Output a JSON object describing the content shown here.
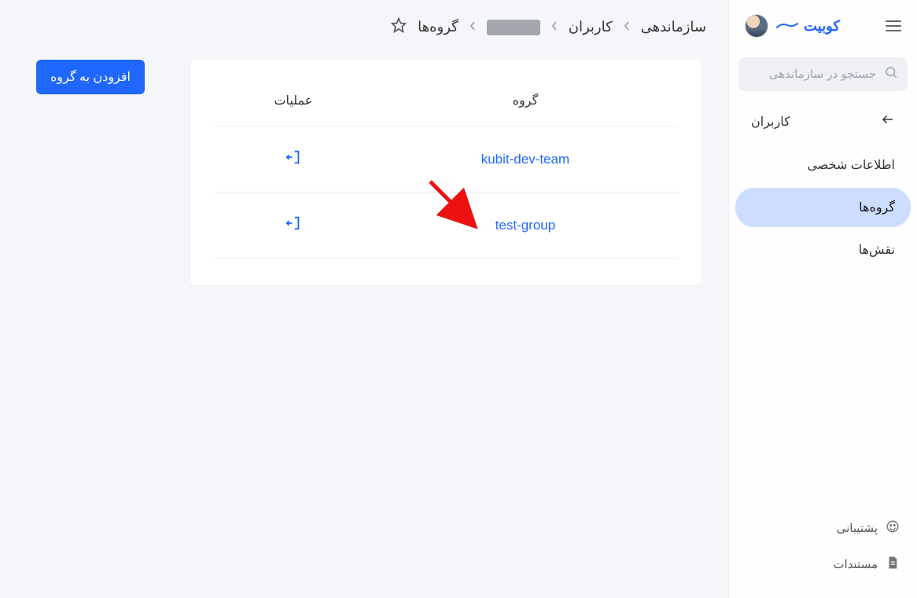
{
  "brand": {
    "name": "کوبیت"
  },
  "search": {
    "placeholder": "جستجو در سازماندهی"
  },
  "sidebar": {
    "items": [
      {
        "label": "کاربران",
        "active": false,
        "has_back": true
      },
      {
        "label": "اطلاعات شخصی",
        "active": false,
        "has_back": false
      },
      {
        "label": "گروه‌ها",
        "active": true,
        "has_back": false
      },
      {
        "label": "نقش‌ها",
        "active": false,
        "has_back": false
      }
    ]
  },
  "footer": {
    "items": [
      {
        "label": "پشتیبانی",
        "icon": "support-icon"
      },
      {
        "label": "مستندات",
        "icon": "document-icon"
      }
    ]
  },
  "breadcrumb": {
    "items": [
      {
        "label": "سازماندهی"
      },
      {
        "label": "کاربران"
      },
      {
        "label": "[redacted]",
        "redacted": true
      },
      {
        "label": "گروه‌ها"
      }
    ]
  },
  "buttons": {
    "add_to_group": "افزودن به گروه"
  },
  "table": {
    "headers": {
      "group": "گروه",
      "actions": "عملیات"
    },
    "rows": [
      {
        "group_name": "kubit-dev-team"
      },
      {
        "group_name": "test-group"
      }
    ]
  },
  "annotation": {
    "arrow_points_to": "leave-group-action-row-0"
  }
}
